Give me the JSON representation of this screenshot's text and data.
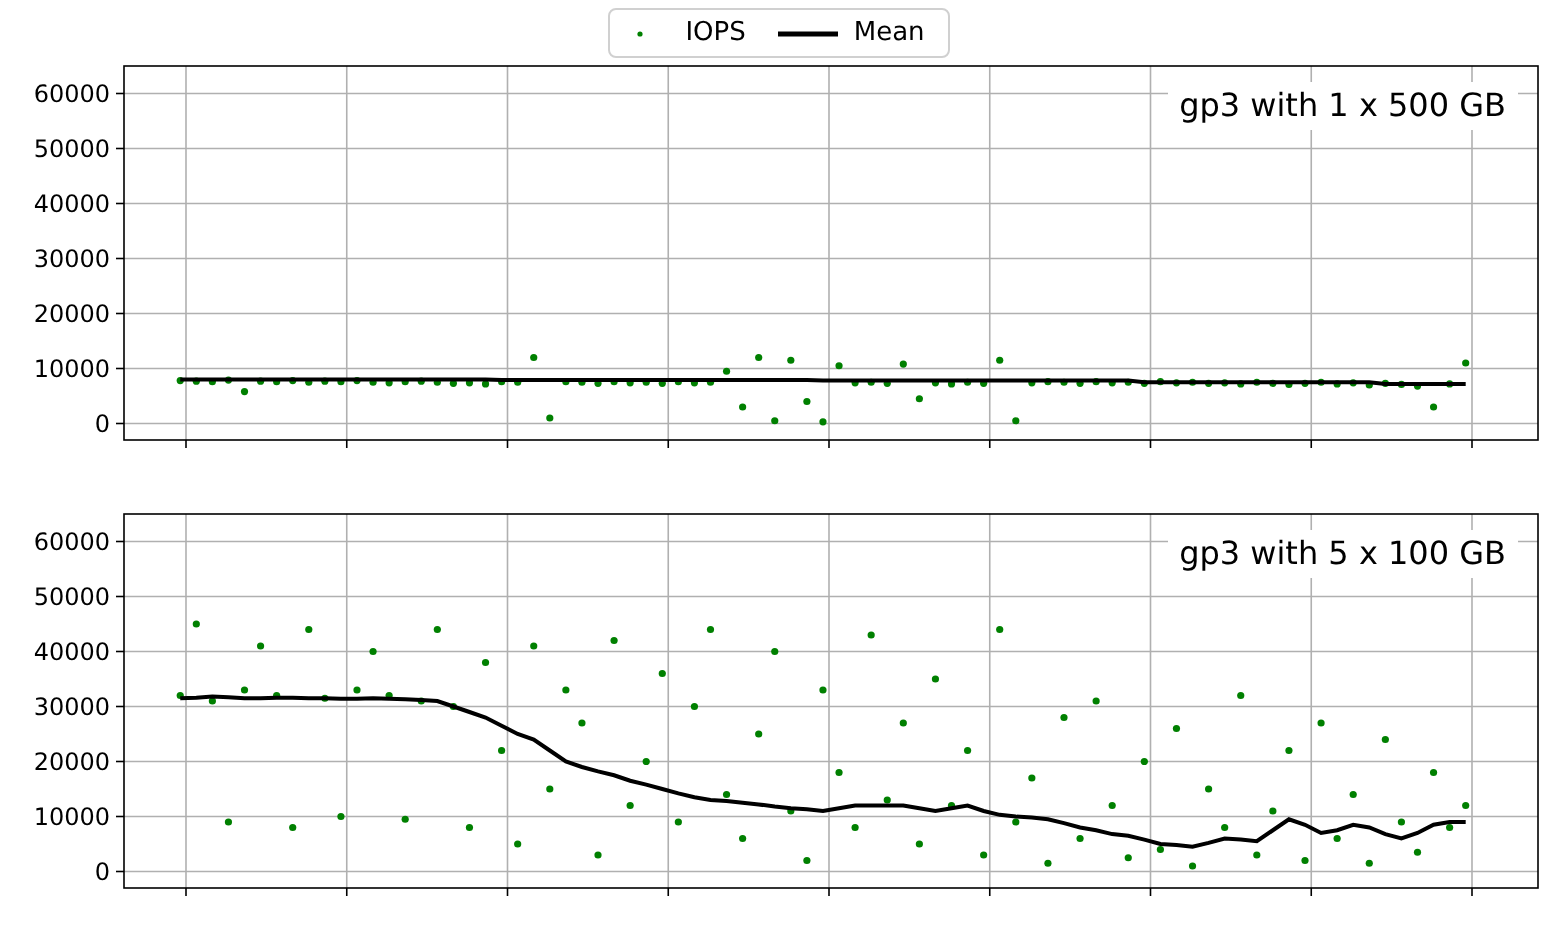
{
  "plots": [
    {
      "title": "gp3 with 1 x 500 GB",
      "chart_data": {
        "type": "scatter",
        "grid": true,
        "ylim": [
          -3000,
          65000
        ],
        "yticks": [
          {
            "value": 0,
            "label": "0"
          },
          {
            "value": 10000,
            "label": "10000"
          },
          {
            "value": 20000,
            "label": "20000"
          },
          {
            "value": 30000,
            "label": "30000"
          },
          {
            "value": 40000,
            "label": "40000"
          },
          {
            "value": 50000,
            "label": "50000"
          },
          {
            "value": 60000,
            "label": "60000"
          }
        ],
        "series": [
          {
            "name": "IOPS",
            "type": "scatter",
            "color": "#008000",
            "values": [
              null,
              null,
              null,
              7800,
              7700,
              7600,
              7900,
              5800,
              7700,
              7600,
              7800,
              7500,
              7700,
              7600,
              7800,
              7500,
              7400,
              7600,
              7700,
              7500,
              7300,
              7400,
              7200,
              7600,
              7500,
              12000,
              1000,
              7600,
              7500,
              7300,
              7600,
              7400,
              7500,
              7300,
              7600,
              7400,
              7500,
              9500,
              3000,
              12000,
              500,
              11500,
              4000,
              300,
              10500,
              7400,
              7500,
              7300,
              10800,
              4500,
              7400,
              7200,
              7500,
              7300,
              11500,
              500,
              7400,
              7600,
              7500,
              7300,
              7600,
              7400,
              7500,
              7300,
              7600,
              7400,
              7500,
              7300,
              7400,
              7200,
              7500,
              7300,
              7100,
              7300,
              7500,
              7200,
              7400,
              7000,
              7300,
              7100,
              6800,
              3000,
              7200,
              11000,
              null,
              null,
              null,
              null
            ]
          },
          {
            "name": "Mean",
            "type": "line",
            "color": "#000000",
            "values": [
              null,
              null,
              null,
              8000,
              8000,
              8000,
              8000,
              8000,
              8000,
              8000,
              8000,
              8000,
              8000,
              8000,
              8000,
              8000,
              8000,
              8000,
              8000,
              8000,
              8000,
              8000,
              8000,
              7900,
              7900,
              7900,
              7900,
              7900,
              7900,
              7900,
              7900,
              7900,
              7900,
              7900,
              7900,
              7900,
              7900,
              7900,
              7900,
              7900,
              7900,
              7900,
              7900,
              7800,
              7800,
              7800,
              7800,
              7800,
              7800,
              7800,
              7800,
              7800,
              7800,
              7800,
              7800,
              7800,
              7800,
              7800,
              7800,
              7800,
              7800,
              7800,
              7800,
              7500,
              7500,
              7500,
              7500,
              7500,
              7500,
              7500,
              7500,
              7500,
              7500,
              7500,
              7500,
              7500,
              7500,
              7500,
              7200,
              7200,
              7200,
              7200,
              7200,
              7200,
              null,
              null,
              null,
              null
            ]
          }
        ]
      }
    },
    {
      "title": "gp3 with 5 x 100 GB",
      "chart_data": {
        "type": "scatter",
        "grid": true,
        "ylim": [
          -3000,
          65000
        ],
        "yticks": [
          {
            "value": 0,
            "label": "0"
          },
          {
            "value": 10000,
            "label": "10000"
          },
          {
            "value": 20000,
            "label": "20000"
          },
          {
            "value": 30000,
            "label": "30000"
          },
          {
            "value": 40000,
            "label": "40000"
          },
          {
            "value": 50000,
            "label": "50000"
          },
          {
            "value": 60000,
            "label": "60000"
          }
        ],
        "series": [
          {
            "type": "scatter",
            "color": "#008000",
            "values": [
              null,
              null,
              null,
              32000,
              45000,
              31000,
              9000,
              33000,
              41000,
              32000,
              8000,
              44000,
              31500,
              10000,
              33000,
              40000,
              32000,
              9500,
              31000,
              44000,
              30000,
              8000,
              38000,
              22000,
              5000,
              41000,
              15000,
              33000,
              27000,
              3000,
              42000,
              12000,
              20000,
              36000,
              9000,
              30000,
              44000,
              14000,
              6000,
              25000,
              40000,
              11000,
              2000,
              33000,
              18000,
              8000,
              43000,
              13000,
              27000,
              5000,
              35000,
              12000,
              22000,
              3000,
              44000,
              9000,
              17000,
              1500,
              28000,
              6000,
              31000,
              12000,
              2500,
              20000,
              4000,
              26000,
              1000,
              15000,
              8000,
              32000,
              3000,
              11000,
              22000,
              2000,
              27000,
              6000,
              14000,
              1500,
              24000,
              9000,
              3500,
              18000,
              8000,
              12000,
              null,
              null,
              null,
              null
            ]
          },
          {
            "type": "line",
            "color": "#000000",
            "values": [
              null,
              null,
              null,
              31500,
              31600,
              31800,
              31700,
              31500,
              31500,
              31600,
              31600,
              31500,
              31500,
              31400,
              31400,
              31500,
              31400,
              31300,
              31200,
              31000,
              30000,
              29000,
              28000,
              26500,
              25000,
              24000,
              22000,
              20000,
              19000,
              18200,
              17500,
              16500,
              15800,
              15000,
              14200,
              13500,
              13000,
              12800,
              12500,
              12200,
              11800,
              11500,
              11300,
              11000,
              11500,
              12000,
              12000,
              12000,
              12000,
              11500,
              11000,
              11500,
              12000,
              11000,
              10300,
              10000,
              9800,
              9500,
              8800,
              8000,
              7500,
              6800,
              6500,
              5800,
              5000,
              4800,
              4500,
              5200,
              6000,
              5800,
              5500,
              7500,
              9500,
              8500,
              7000,
              7500,
              8500,
              8000,
              6800,
              6000,
              7000,
              8500,
              9000,
              9000,
              null,
              null,
              null,
              null
            ]
          }
        ]
      }
    }
  ]
}
